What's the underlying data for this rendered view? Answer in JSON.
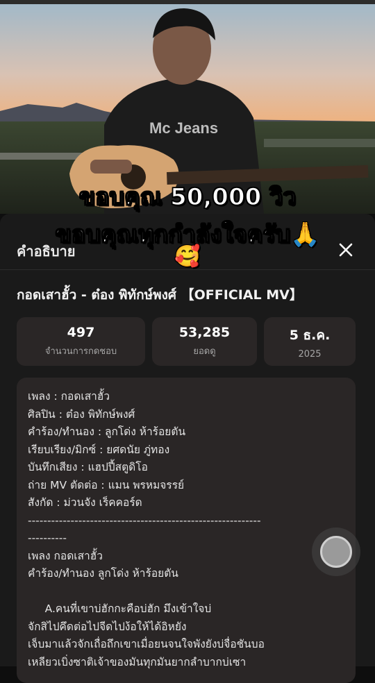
{
  "video": {
    "shirt_text": "Mc Jeans"
  },
  "overlay": {
    "line1": "ขอบคุณ 50,000 วิว",
    "line2": "ขอบคุณทุกกำลังใจครับ🙏",
    "line3": "🥰"
  },
  "sheet": {
    "title": "คำอธิบาย",
    "close_icon": "close-icon",
    "video_title": "กอดเสาฮั้ว - ต๋อง พิทักษ์พงศ์ 【OFFICIAL MV】",
    "stats": [
      {
        "value": "497",
        "label": "จำนวนการกดชอบ"
      },
      {
        "value": "53,285",
        "label": "ยอดดู"
      },
      {
        "value": "5 ธ.ค.",
        "label": "2025"
      }
    ],
    "description_lines": [
      "เพลง : กอดเสาฮั้ว",
      "ศิลปิน : ต๋อง พิทักษ์พงศ์",
      "คำร้อง/ทำนอง : ลูกโด่ง ห้าร้อยตัน",
      "เรียบเรียง/มิกซ์ : ยศดนัย ภู่ทอง",
      "บันทึกเสียง : แฮปปี้สตูดิโอ",
      "ถ่าย MV ตัดต่อ : แมน พรหมจรรย์",
      "สังกัด : ม่วนจัง เร็คคอร์ด",
      "------------------------------------------------------------",
      "----------",
      "เพลง กอดเสาฮั้ว",
      "คำร้อง/ทำนอง ลูกโด่ง ห้าร้อยตัน",
      "",
      "     A.คนที่เขาบ่ฮักกะคือบ่ฮัก มึงเข้าใจบ่",
      "จักสิไปคึดต่อไปจีดไปง้อให้ได้อิหยัง",
      "เจ็บมาแล้วจักเถื่อถึกเขาเมื่อยนจนใจพังยังบ่จื่อชันบอ",
      "เหลียวเบิ่งซาติเจ้าของมันทุกมันยากลำบากบ่เซา"
    ]
  }
}
